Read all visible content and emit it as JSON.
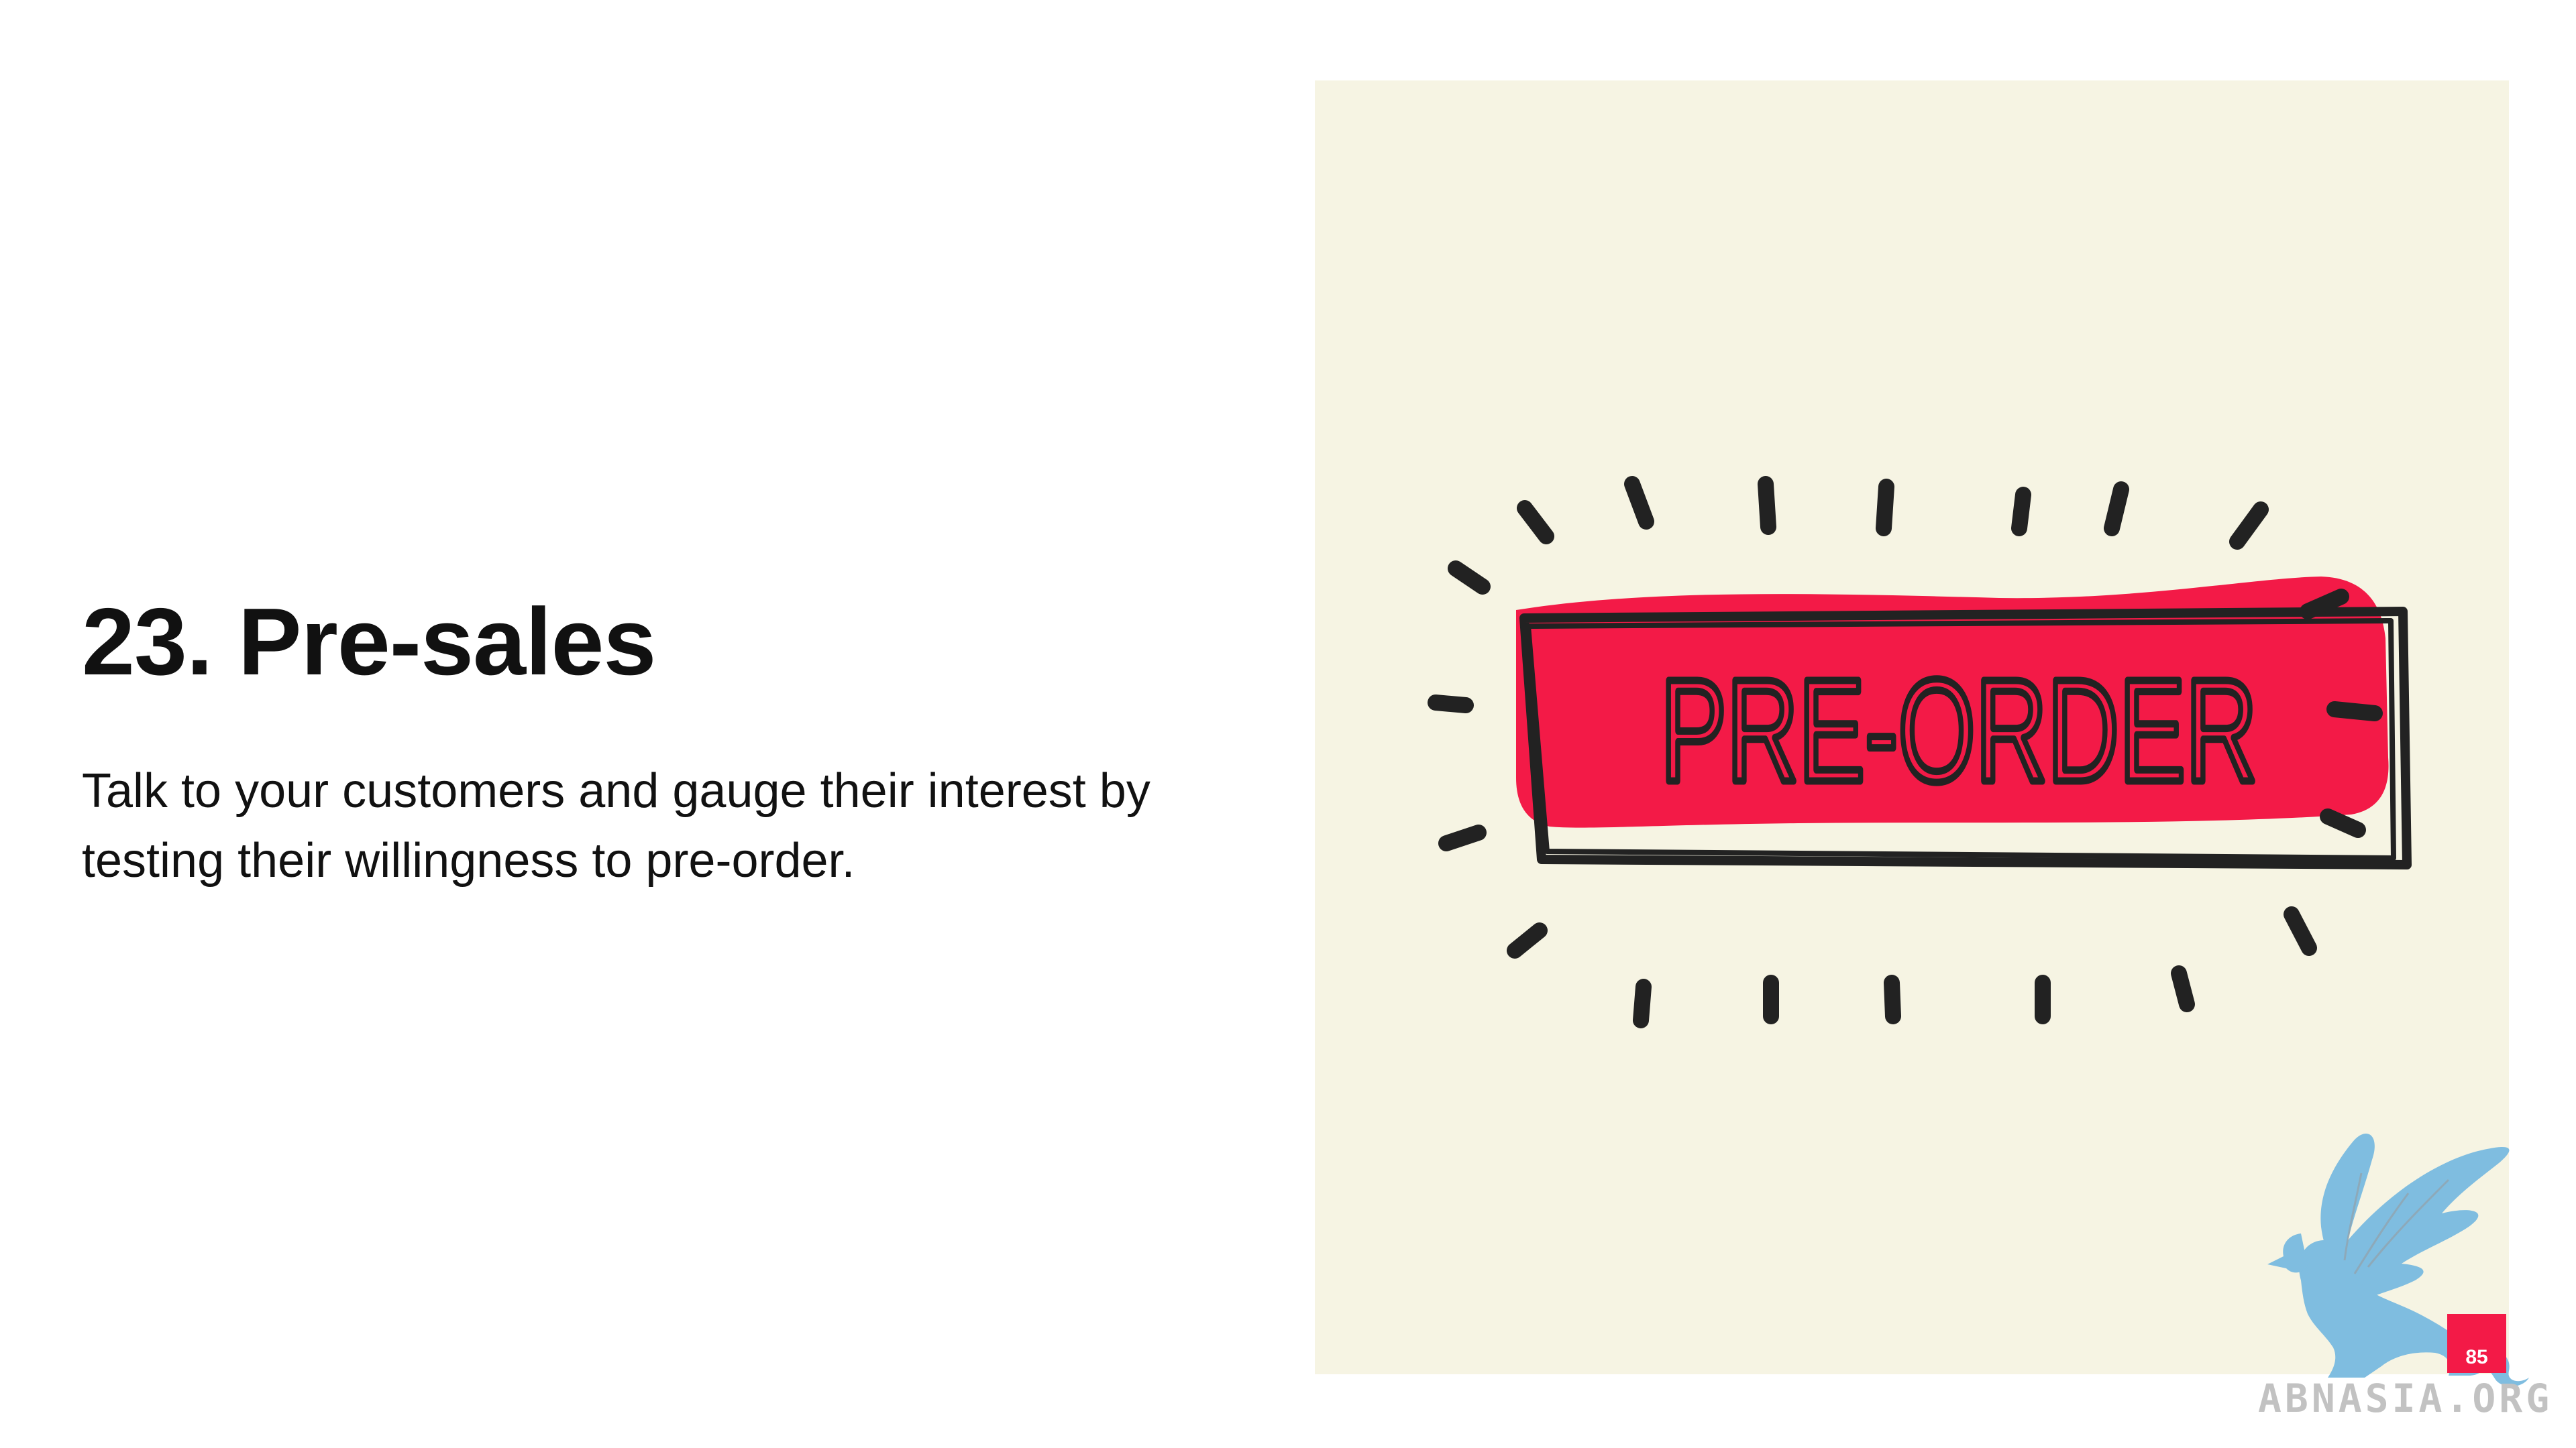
{
  "slide": {
    "title": "23. Pre-sales",
    "body": "Talk to your customers and gauge their interest by testing their willingness to pre-order.",
    "page_number": "85"
  },
  "illustration": {
    "button_label": "PRE-ORDER",
    "background_color": "#f6f4e3",
    "button_color": "#f31a47",
    "ink_color": "#222222"
  },
  "watermark": {
    "text": "ABNASIA.ORG",
    "color": "#7fbde0"
  },
  "colors": {
    "text": "#111111",
    "accent": "#f31a47",
    "background": "#ffffff"
  }
}
